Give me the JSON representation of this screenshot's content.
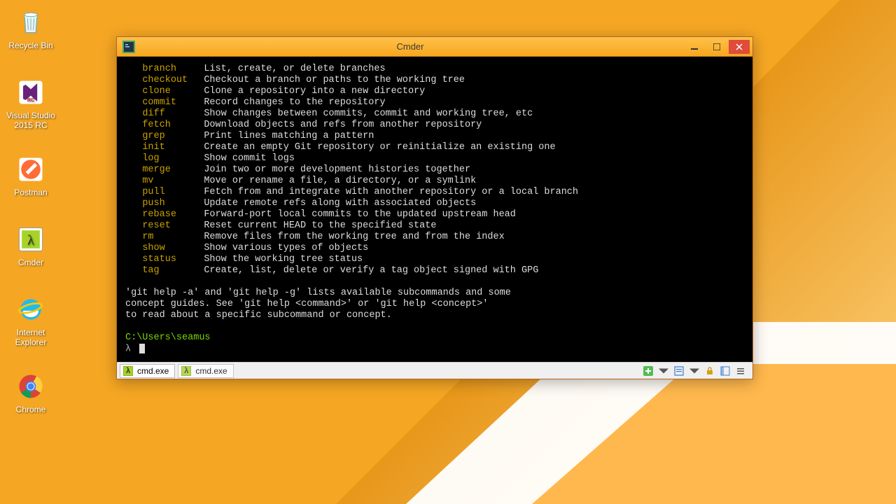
{
  "desktop": {
    "icons": [
      {
        "label": "Recycle Bin"
      },
      {
        "label": "Visual Studio 2015 RC"
      },
      {
        "label": "Postman"
      },
      {
        "label": "Cmder"
      },
      {
        "label": "Internet Explorer"
      },
      {
        "label": "Chrome"
      }
    ]
  },
  "window": {
    "title": "Cmder",
    "tabs": [
      {
        "label": "cmd.exe"
      },
      {
        "label": "cmd.exe"
      }
    ]
  },
  "terminal": {
    "commands": [
      {
        "name": "branch",
        "desc": "List, create, or delete branches"
      },
      {
        "name": "checkout",
        "desc": "Checkout a branch or paths to the working tree"
      },
      {
        "name": "clone",
        "desc": "Clone a repository into a new directory"
      },
      {
        "name": "commit",
        "desc": "Record changes to the repository"
      },
      {
        "name": "diff",
        "desc": "Show changes between commits, commit and working tree, etc"
      },
      {
        "name": "fetch",
        "desc": "Download objects and refs from another repository"
      },
      {
        "name": "grep",
        "desc": "Print lines matching a pattern"
      },
      {
        "name": "init",
        "desc": "Create an empty Git repository or reinitialize an existing one"
      },
      {
        "name": "log",
        "desc": "Show commit logs"
      },
      {
        "name": "merge",
        "desc": "Join two or more development histories together"
      },
      {
        "name": "mv",
        "desc": "Move or rename a file, a directory, or a symlink"
      },
      {
        "name": "pull",
        "desc": "Fetch from and integrate with another repository or a local branch"
      },
      {
        "name": "push",
        "desc": "Update remote refs along with associated objects"
      },
      {
        "name": "rebase",
        "desc": "Forward-port local commits to the updated upstream head"
      },
      {
        "name": "reset",
        "desc": "Reset current HEAD to the specified state"
      },
      {
        "name": "rm",
        "desc": "Remove files from the working tree and from the index"
      },
      {
        "name": "show",
        "desc": "Show various types of objects"
      },
      {
        "name": "status",
        "desc": "Show the working tree status"
      },
      {
        "name": "tag",
        "desc": "Create, list, delete or verify a tag object signed with GPG"
      }
    ],
    "help_lines": [
      "'git help -a' and 'git help -g' lists available subcommands and some",
      "concept guides. See 'git help <command>' or 'git help <concept>'",
      "to read about a specific subcommand or concept."
    ],
    "prompt_path": "C:\\Users\\seamus",
    "prompt_symbol": "λ"
  }
}
